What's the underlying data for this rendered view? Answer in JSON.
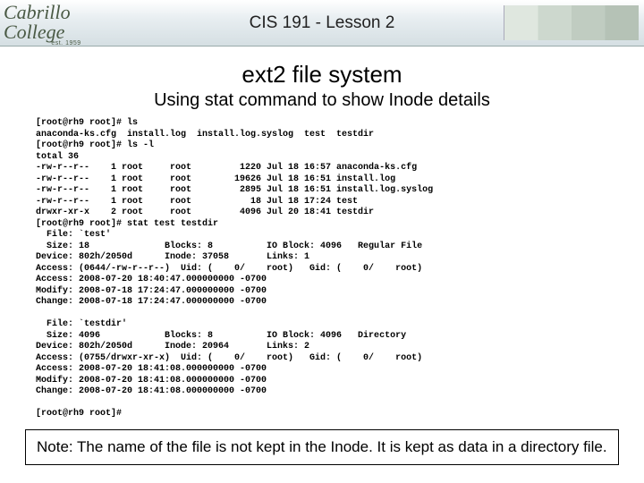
{
  "header": {
    "logo_text": "Cabrillo College",
    "logo_sub": "est. 1959",
    "course": "CIS 191 - Lesson 2"
  },
  "titles": {
    "main": "ext2 file system",
    "sub": "Using stat command to show Inode details"
  },
  "terminal": "[root@rh9 root]# ls\nanaconda-ks.cfg  install.log  install.log.syslog  test  testdir\n[root@rh9 root]# ls -l\ntotal 36\n-rw-r--r--    1 root     root         1220 Jul 18 16:57 anaconda-ks.cfg\n-rw-r--r--    1 root     root        19626 Jul 18 16:51 install.log\n-rw-r--r--    1 root     root         2895 Jul 18 16:51 install.log.syslog\n-rw-r--r--    1 root     root           18 Jul 18 17:24 test\ndrwxr-xr-x    2 root     root         4096 Jul 20 18:41 testdir\n[root@rh9 root]# stat test testdir\n  File: `test'\n  Size: 18              Blocks: 8          IO Block: 4096   Regular File\nDevice: 802h/2050d      Inode: 37058       Links: 1\nAccess: (0644/-rw-r--r--)  Uid: (    0/    root)   Gid: (    0/    root)\nAccess: 2008-07-20 18:40:47.000000000 -0700\nModify: 2008-07-18 17:24:47.000000000 -0700\nChange: 2008-07-18 17:24:47.000000000 -0700\n\n  File: `testdir'\n  Size: 4096            Blocks: 8          IO Block: 4096   Directory\nDevice: 802h/2050d      Inode: 20964       Links: 2\nAccess: (0755/drwxr-xr-x)  Uid: (    0/    root)   Gid: (    0/    root)\nAccess: 2008-07-20 18:41:08.000000000 -0700\nModify: 2008-07-20 18:41:08.000000000 -0700\nChange: 2008-07-20 18:41:08.000000000 -0700\n\n[root@rh9 root]#",
  "note": "Note:  The name of the file is not kept in the Inode.  It is kept as data in a directory file."
}
